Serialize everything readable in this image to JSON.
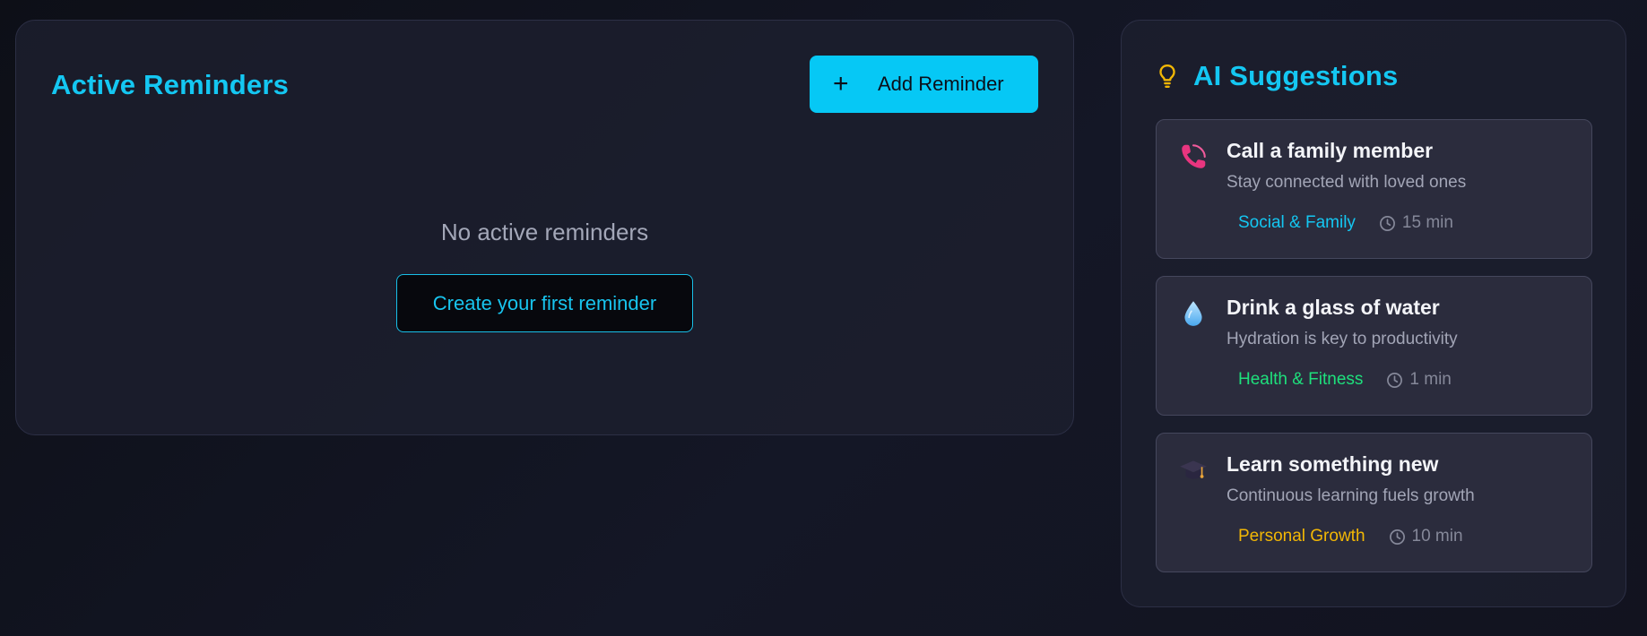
{
  "reminders": {
    "title": "Active Reminders",
    "add_button": {
      "icon": "plus-icon",
      "label": "Add Reminder"
    },
    "empty_state": {
      "text": "No active reminders",
      "button_label": "Create your first reminder"
    }
  },
  "suggestions": {
    "title": "AI Suggestions",
    "title_icon": "lightbulb-icon",
    "items": [
      {
        "icon": "phone-icon",
        "title": "Call a family member",
        "description": "Stay connected with loved ones",
        "category": "Social & Family",
        "category_color": "#14c7f2",
        "duration": "15 min"
      },
      {
        "icon": "water-drop-icon",
        "title": "Drink a glass of water",
        "description": "Hydration is key to productivity",
        "category": "Health & Fitness",
        "category_color": "#1ee07c",
        "duration": "1 min"
      },
      {
        "icon": "graduation-cap-icon",
        "title": "Learn something new",
        "description": "Continuous learning fuels growth",
        "category": "Personal Growth",
        "category_color": "#f2b705",
        "duration": "10 min"
      }
    ]
  },
  "colors": {
    "accent": "#06c8f5",
    "background": "#12131f",
    "panel": "#1c1e2e",
    "card": "#2b2c3d"
  }
}
